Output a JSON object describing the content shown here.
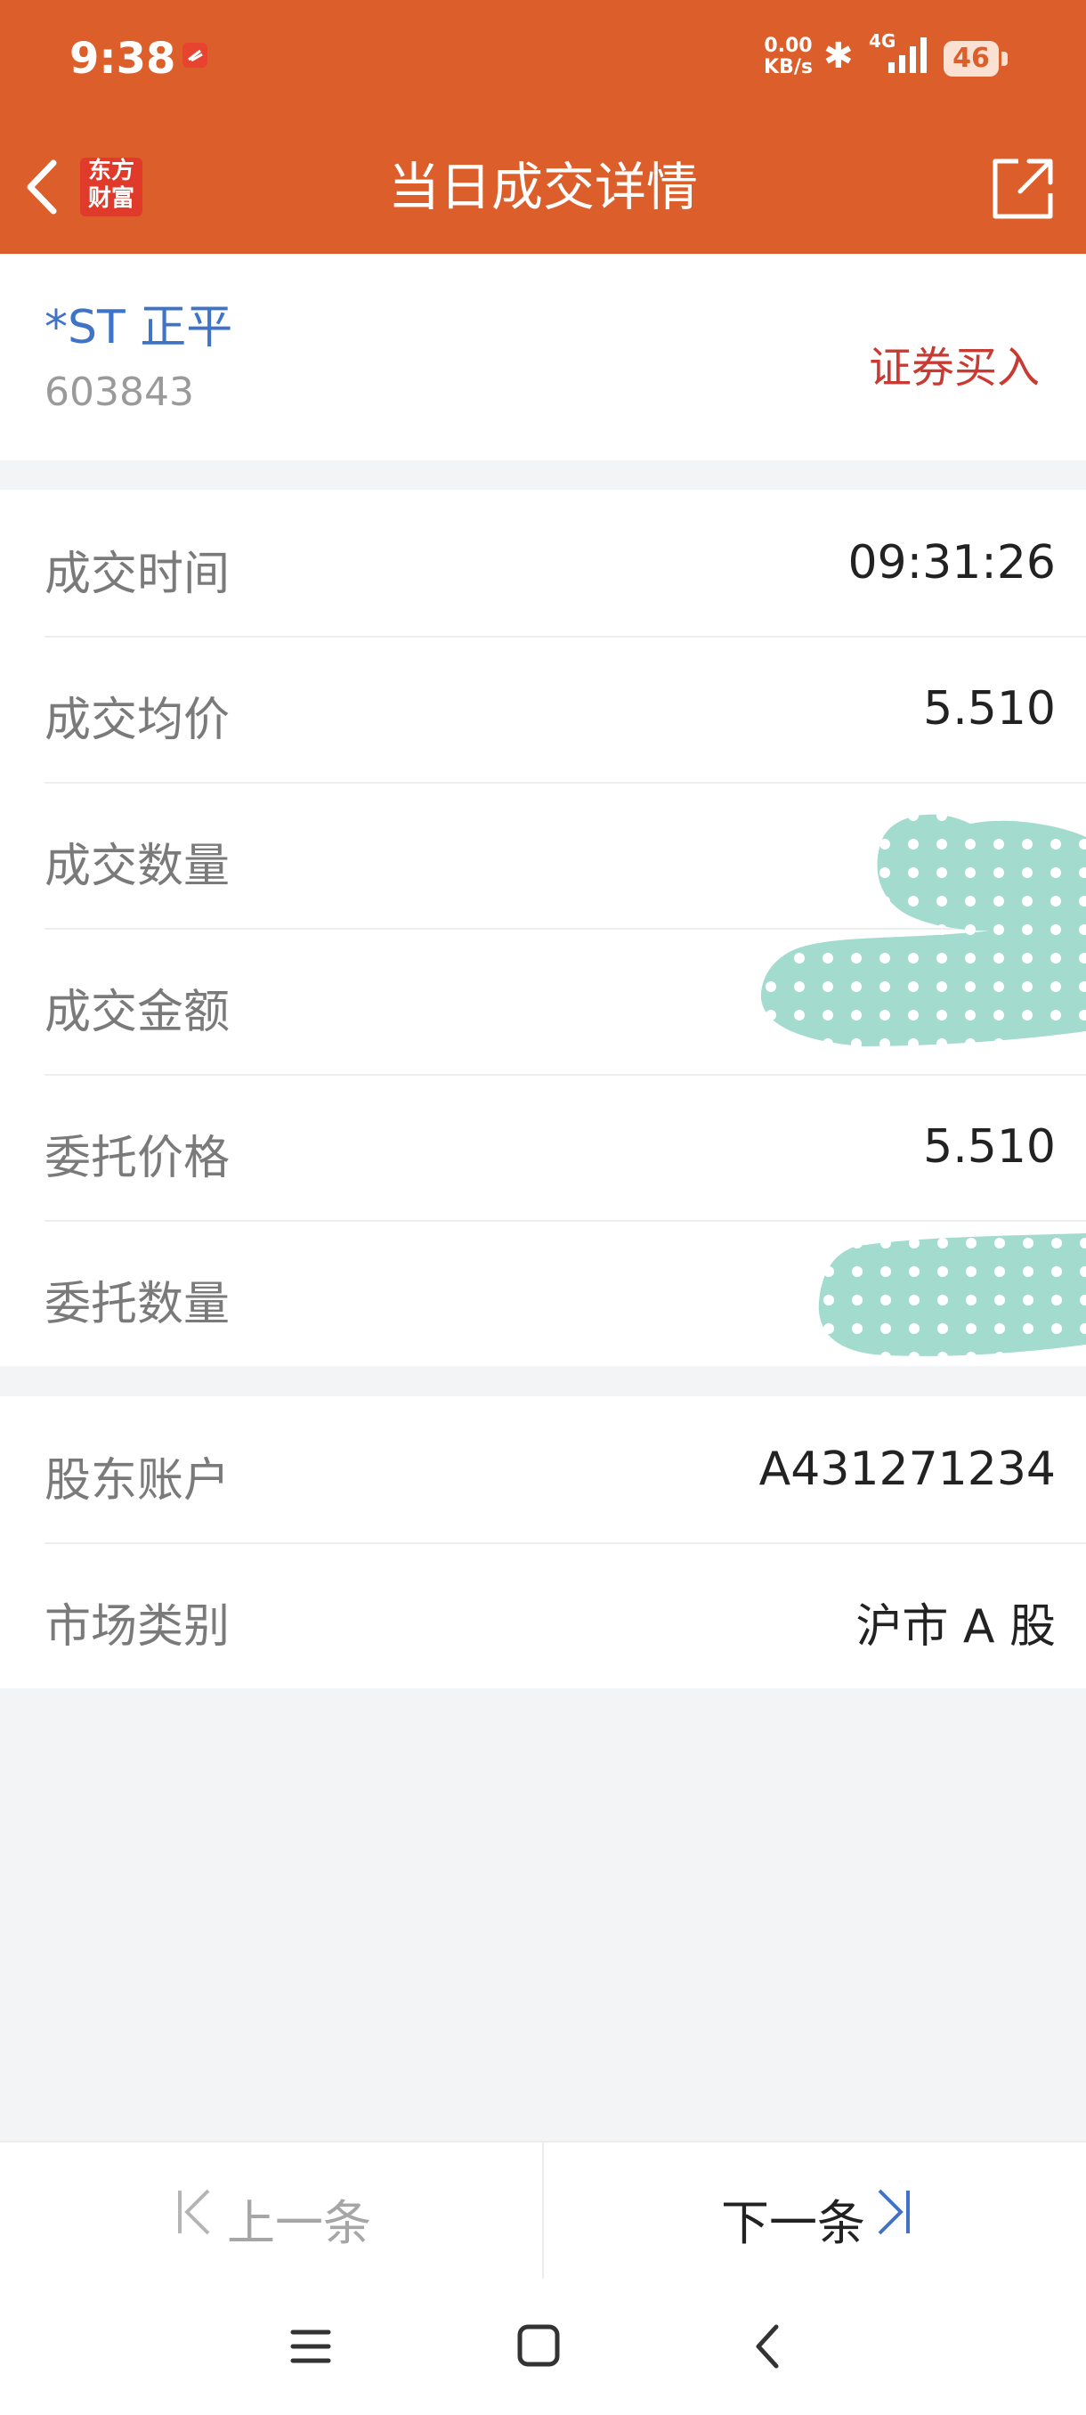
{
  "status_bar": {
    "time": "9:38",
    "net_speed_value": "0.00",
    "net_speed_unit": "KB/s",
    "network": "4G",
    "battery": "46"
  },
  "nav": {
    "logo_line1": "东方",
    "logo_line2": "财富",
    "title": "当日成交详情"
  },
  "stock": {
    "name": "*ST 正平",
    "code": "603843",
    "trade_type": "证券买入"
  },
  "details": [
    {
      "label": "成交时间",
      "value": "09:31:26"
    },
    {
      "label": "成交均价",
      "value": "5.510"
    },
    {
      "label": "成交数量",
      "value": ""
    },
    {
      "label": "成交金额",
      "value": ""
    },
    {
      "label": "委托价格",
      "value": "5.510"
    },
    {
      "label": "委托数量",
      "value": ""
    }
  ],
  "account": [
    {
      "label": "股东账户",
      "value": "A431271234"
    },
    {
      "label": "市场类别",
      "value": "沪市 A 股"
    }
  ],
  "footer": {
    "prev_label": "上一条",
    "next_label": "下一条"
  },
  "colors": {
    "brand": "#dc5e2b",
    "stock_name": "#3f73c7",
    "trade_type": "#c93a32",
    "redaction": "#a3dccf"
  }
}
